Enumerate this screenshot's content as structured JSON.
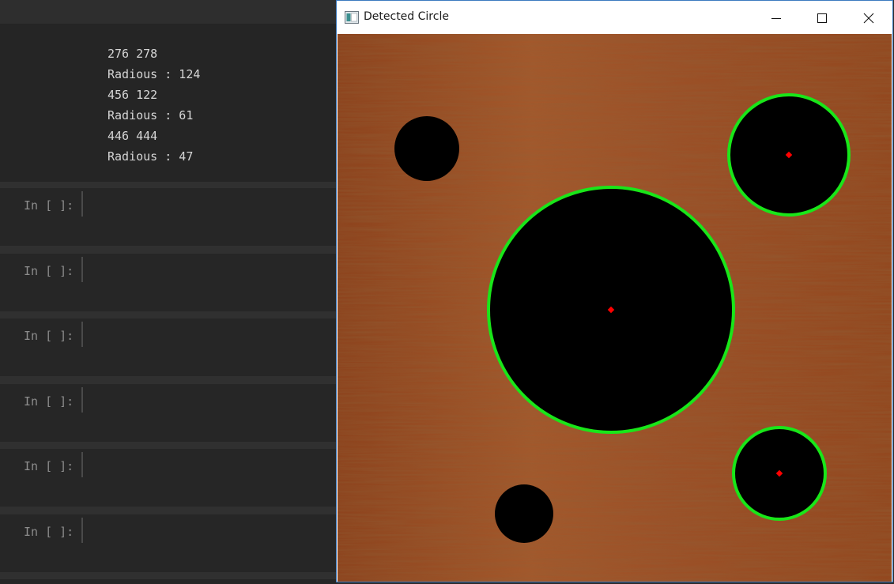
{
  "notebook": {
    "output_lines": [
      "276 278",
      "Radious : 124",
      "456 122",
      "Radious : 61",
      "446 444",
      "Radious : 47"
    ],
    "cells": [
      {
        "prompt": "In [ ]:"
      },
      {
        "prompt": "In [ ]:"
      },
      {
        "prompt": "In [ ]:"
      },
      {
        "prompt": "In [ ]:"
      },
      {
        "prompt": "In [ ]:"
      },
      {
        "prompt": "In [ ]:"
      }
    ]
  },
  "cv_window": {
    "title": "Detected Circle",
    "controls": {
      "minimize_icon": "minimize-icon",
      "maximize_icon": "maximize-icon",
      "close_icon": "close-icon"
    },
    "image": {
      "background": "wood-texture",
      "wood_color": "#9a4e24",
      "detected_outline_color": "#19e619",
      "center_color": "#ff0000",
      "hole_color": "#000000"
    }
  }
}
